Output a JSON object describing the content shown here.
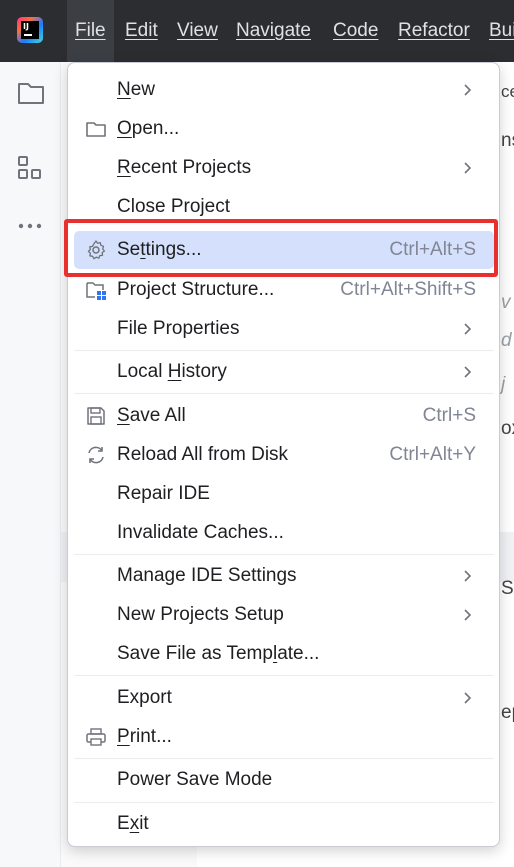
{
  "menubar": {
    "items": [
      {
        "label": "File"
      },
      {
        "label": "Edit"
      },
      {
        "label": "View"
      },
      {
        "label": "Navigate"
      },
      {
        "label": "Code"
      },
      {
        "label": "Refactor"
      },
      {
        "label": "Bui"
      }
    ]
  },
  "editor": {
    "fragments": [
      "ce",
      "ns",
      "v",
      "d",
      "j",
      "ox",
      "Se",
      "ep"
    ]
  },
  "file_menu": {
    "items": [
      {
        "label": "New",
        "mnemonic": "N",
        "rest": "ew",
        "submenu": true
      },
      {
        "label": "Open...",
        "mnemonic": "O",
        "rest": "pen...",
        "icon": "folder-icon"
      },
      {
        "label": "Recent Projects",
        "mnemonic": "R",
        "rest": "ecent Projects",
        "submenu": true
      },
      {
        "label": "Close Project"
      },
      {
        "label": "Settings...",
        "pre": "Se",
        "mnemonic": "t",
        "rest": "tings...",
        "shortcut": "Ctrl+Alt+S",
        "icon": "gear-icon",
        "selected": true
      },
      {
        "label": "Project Structure...",
        "shortcut": "Ctrl+Alt+Shift+S",
        "icon": "project-structure-icon"
      },
      {
        "label": "File Properties",
        "submenu": true
      },
      {
        "label": "Local History",
        "pre": "Local ",
        "mnemonic": "H",
        "rest": "istory",
        "submenu": true
      },
      {
        "label": "Save All",
        "mnemonic": "S",
        "rest": "ave All",
        "shortcut": "Ctrl+S",
        "icon": "save-icon"
      },
      {
        "label": "Reload All from Disk",
        "shortcut": "Ctrl+Alt+Y",
        "icon": "reload-icon"
      },
      {
        "label": "Repair IDE"
      },
      {
        "label": "Invalidate Caches..."
      },
      {
        "label": "Manage IDE Settings",
        "submenu": true
      },
      {
        "label": "New Projects Setup",
        "submenu": true
      },
      {
        "label": "Save File as Template...",
        "pre": "Save File as Temp",
        "mnemonic": "l",
        "rest": "ate..."
      },
      {
        "label": "Export",
        "submenu": true
      },
      {
        "label": "Print...",
        "mnemonic": "P",
        "rest": "rint...",
        "icon": "print-icon"
      },
      {
        "label": "Power Save Mode"
      },
      {
        "label": "Exit",
        "pre": "E",
        "mnemonic": "x",
        "rest": "it"
      }
    ]
  },
  "colors": {
    "titlebar": "#2b2d30",
    "selection": "#d5e1fc",
    "highlight_annotation": "#e8312f"
  }
}
